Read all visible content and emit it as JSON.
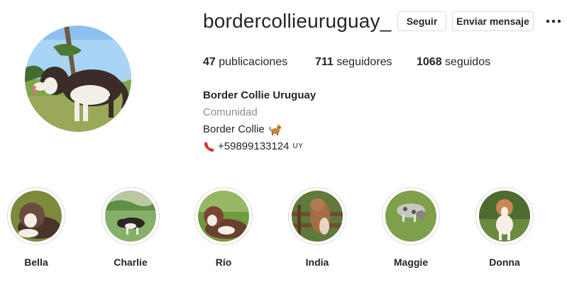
{
  "profile": {
    "username": "bordercollieuruguay_",
    "follow_label": "Seguir",
    "message_label": "Enviar mensaje"
  },
  "stats": {
    "posts_count": "47",
    "posts_label": "publicaciones",
    "followers_count": "711",
    "followers_label": "seguidores",
    "following_count": "1068",
    "following_label": "seguidos"
  },
  "bio": {
    "name": "Border Collie Uruguay",
    "category": "Comunidad",
    "description": "Border Collie",
    "description_emoji_icon": "dog-emoji-icon",
    "phone_icon": "telephone-receiver-icon",
    "phone": "+59899133124",
    "phone_country": "UY"
  },
  "highlights": [
    {
      "label": "Bella"
    },
    {
      "label": "Charlie"
    },
    {
      "label": "Río"
    },
    {
      "label": "India"
    },
    {
      "label": "Maggie"
    },
    {
      "label": "Donna"
    }
  ],
  "colors": {
    "text": "#262626",
    "muted": "#8e8e8e",
    "border": "#dbdbdb",
    "phone_icon": "#d32f2f"
  }
}
